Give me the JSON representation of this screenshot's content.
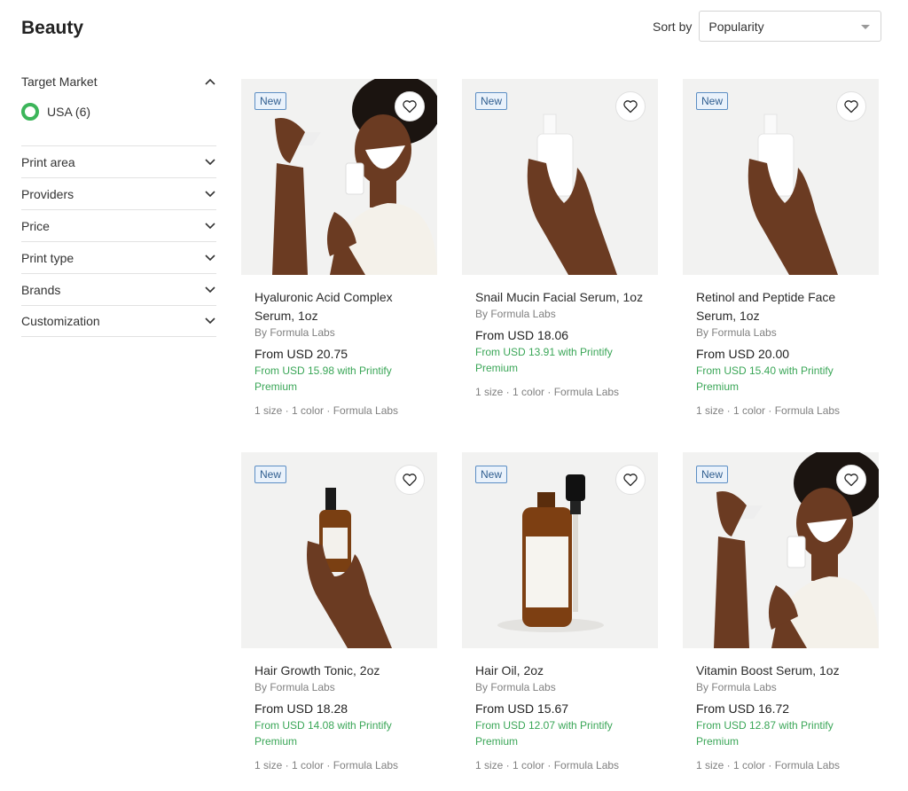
{
  "page": {
    "title": "Beauty"
  },
  "sort": {
    "label": "Sort by",
    "value": "Popularity"
  },
  "sidebar": {
    "target_market": {
      "label": "Target Market",
      "option": "USA (6)"
    },
    "filters": [
      "Print area",
      "Providers",
      "Price",
      "Print type",
      "Brands",
      "Customization"
    ]
  },
  "products": [
    {
      "badge": "New",
      "title": "Hyaluronic Acid Complex Serum, 1oz",
      "brand": "By Formula Labs",
      "price": "From USD 20.75",
      "premium": "From USD 15.98 with Printify Premium",
      "meta": "1 size · 1 color · Formula Labs"
    },
    {
      "badge": "New",
      "title": "Snail Mucin Facial Serum, 1oz",
      "brand": "By Formula Labs",
      "price": "From USD 18.06",
      "premium": "From USD 13.91 with Printify Premium",
      "meta": "1 size · 1 color · Formula Labs"
    },
    {
      "badge": "New",
      "title": "Retinol and Peptide Face Serum, 1oz",
      "brand": "By Formula Labs",
      "price": "From USD 20.00",
      "premium": "From USD 15.40 with Printify Premium",
      "meta": "1 size · 1 color · Formula Labs"
    },
    {
      "badge": "New",
      "title": "Hair Growth Tonic, 2oz",
      "brand": "By Formula Labs",
      "price": "From USD 18.28",
      "premium": "From USD 14.08 with Printify Premium",
      "meta": "1 size · 1 color · Formula Labs"
    },
    {
      "badge": "New",
      "title": "Hair Oil, 2oz",
      "brand": "By Formula Labs",
      "price": "From USD 15.67",
      "premium": "From USD 12.07 with Printify Premium",
      "meta": "1 size · 1 color · Formula Labs"
    },
    {
      "badge": "New",
      "title": "Vitamin Boost Serum, 1oz",
      "brand": "By Formula Labs",
      "price": "From USD 16.72",
      "premium": "From USD 12.87 with Printify Premium",
      "meta": "1 size · 1 color · Formula Labs"
    }
  ],
  "colors": {
    "accent_green": "#3cb55a",
    "premium_text": "#3aa657",
    "badge_border": "#5c8ec4"
  },
  "icons": {
    "favorite": "heart-outline-icon",
    "collapse": "chevron-up-icon",
    "expand": "chevron-down-icon",
    "dropdown": "caret-down-icon"
  }
}
